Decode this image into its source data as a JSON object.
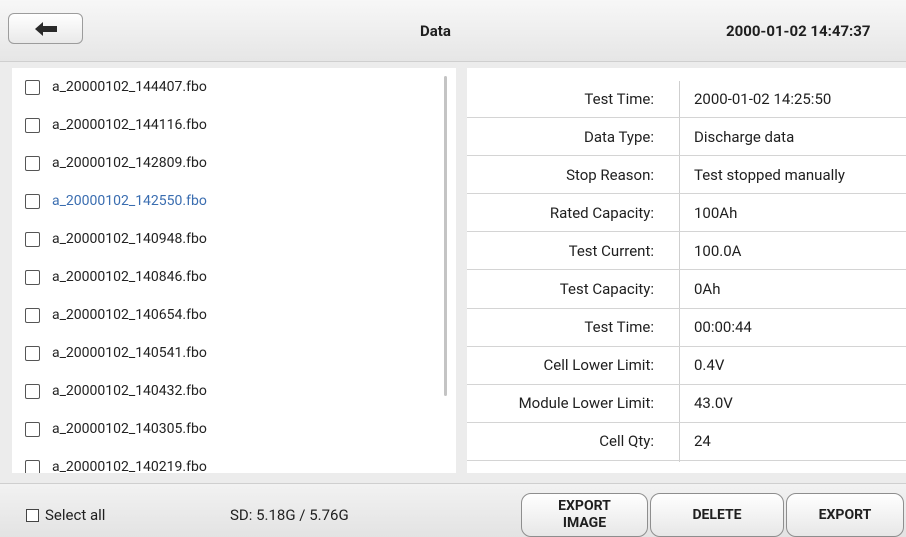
{
  "header": {
    "title": "Data",
    "datetime": "2000-01-02 14:47:37"
  },
  "files": [
    {
      "name": "a_20000102_144407.fbo",
      "active": false
    },
    {
      "name": "a_20000102_144116.fbo",
      "active": false
    },
    {
      "name": "a_20000102_142809.fbo",
      "active": false
    },
    {
      "name": "a_20000102_142550.fbo",
      "active": true
    },
    {
      "name": "a_20000102_140948.fbo",
      "active": false
    },
    {
      "name": "a_20000102_140846.fbo",
      "active": false
    },
    {
      "name": "a_20000102_140654.fbo",
      "active": false
    },
    {
      "name": "a_20000102_140541.fbo",
      "active": false
    },
    {
      "name": "a_20000102_140432.fbo",
      "active": false
    },
    {
      "name": "a_20000102_140305.fbo",
      "active": false
    },
    {
      "name": "a_20000102_140219.fbo",
      "active": false
    }
  ],
  "details": [
    {
      "label": "Test Time:",
      "value": "2000-01-02 14:25:50"
    },
    {
      "label": "Data Type:",
      "value": "Discharge data"
    },
    {
      "label": "Stop Reason:",
      "value": "Test stopped manually"
    },
    {
      "label": "Rated Capacity:",
      "value": "100Ah"
    },
    {
      "label": "Test Current:",
      "value": "100.0A"
    },
    {
      "label": "Test Capacity:",
      "value": "0Ah"
    },
    {
      "label": "Test Time:",
      "value": "00:00:44"
    },
    {
      "label": "Cell Lower Limit:",
      "value": "0.4V"
    },
    {
      "label": "Module Lower Limit:",
      "value": "43.0V"
    },
    {
      "label": "Cell Qty:",
      "value": "24"
    }
  ],
  "footer": {
    "select_all": "Select all",
    "sd": "SD: 5.18G / 5.76G",
    "export_image_line1": "EXPORT",
    "export_image_line2": "IMAGE",
    "delete": "DELETE",
    "export": "EXPORT"
  }
}
